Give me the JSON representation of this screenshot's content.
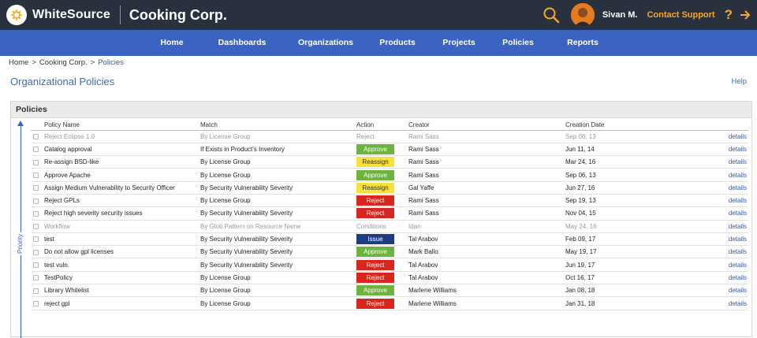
{
  "header": {
    "logo_text": "WhiteSource",
    "company": "Cooking Corp.",
    "user_name": "Sivan M.",
    "contact_support": "Contact Support",
    "help_glyph": "?"
  },
  "nav": {
    "items": [
      {
        "label": "Home"
      },
      {
        "label": "Dashboards"
      },
      {
        "label": "Organizations"
      },
      {
        "label": "Products"
      },
      {
        "label": "Projects"
      },
      {
        "label": "Policies"
      },
      {
        "label": "Reports"
      }
    ]
  },
  "breadcrumb": {
    "home": "Home",
    "sep": ">",
    "org": "Cooking Corp.",
    "current": "Policies"
  },
  "page": {
    "title": "Organizational Policies",
    "help": "Help"
  },
  "panel": {
    "title": "Policies",
    "priority_label": "Priority",
    "columns": {
      "name": "Policy Name",
      "match": "Match",
      "action": "Action",
      "creator": "Creator",
      "date": "Creation Date"
    },
    "rows": [
      {
        "name": "Reject Eclipse 1.0",
        "match": "By License Group",
        "action": "Reject",
        "action_style": "text",
        "creator": "Rami Sass",
        "date": "Sep 06, 13",
        "details": "details",
        "dim": true
      },
      {
        "name": "Catalog approval",
        "match": "If Exists in Product's Inventory",
        "action": "Approve",
        "action_style": "approve",
        "creator": "Rami Sass",
        "date": "Jun 11, 14",
        "details": "details",
        "dim": false
      },
      {
        "name": "Re-assign BSD-like",
        "match": "By License Group",
        "action": "Reassign",
        "action_style": "reassign",
        "creator": "Rami Sass",
        "date": "Mar 24, 16",
        "details": "details",
        "dim": false
      },
      {
        "name": "Approve Apache",
        "match": "By License Group",
        "action": "Approve",
        "action_style": "approve",
        "creator": "Rami Sass",
        "date": "Sep 06, 13",
        "details": "details",
        "dim": false
      },
      {
        "name": "Assign Medium Vulnerability to Security Officer",
        "match": "By Security Vulnerability Severity",
        "action": "Reassign",
        "action_style": "reassign",
        "creator": "Gal Yaffe",
        "date": "Jun 27, 16",
        "details": "details",
        "dim": false
      },
      {
        "name": "Reject GPLs",
        "match": "By License Group",
        "action": "Reject",
        "action_style": "reject",
        "creator": "Rami Sass",
        "date": "Sep 19, 13",
        "details": "details",
        "dim": false
      },
      {
        "name": "Reject high severity security issues",
        "match": "By Security Vulnerability Severity",
        "action": "Reject",
        "action_style": "reject",
        "creator": "Rami Sass",
        "date": "Nov 04, 15",
        "details": "details",
        "dim": false
      },
      {
        "name": "Workflow",
        "match": "By Glob Pattern on Resource Name",
        "action": "Conditions",
        "action_style": "text",
        "creator": "Idan",
        "date": "May 24, 16",
        "details": "details",
        "dim": true
      },
      {
        "name": "test",
        "match": "By Security Vulnerability Severity",
        "action": "Issue",
        "action_style": "issue",
        "creator": "Tal Arabov",
        "date": "Feb 09, 17",
        "details": "details",
        "dim": false
      },
      {
        "name": "Do not allow gpl licenses",
        "match": "By Security Vulnerability Severity",
        "action": "Approve",
        "action_style": "approve",
        "creator": "Mark Ballo",
        "date": "May 19, 17",
        "details": "details",
        "dim": false
      },
      {
        "name": "test vuln.",
        "match": "By Security Vulnerability Severity",
        "action": "Reject",
        "action_style": "reject",
        "creator": "Tal Arabov",
        "date": "Jun 19, 17",
        "details": "details",
        "dim": false
      },
      {
        "name": "TestPolicy",
        "match": "By License Group",
        "action": "Reject",
        "action_style": "reject",
        "creator": "Tal Arabov",
        "date": "Oct 16, 17",
        "details": "details",
        "dim": false
      },
      {
        "name": "Library Whitelist",
        "match": "By License Group",
        "action": "Approve",
        "action_style": "approve",
        "creator": "Marlene Williams",
        "date": "Jan 08, 18",
        "details": "details",
        "dim": false
      },
      {
        "name": "reject gpl",
        "match": "By License Group",
        "action": "Reject",
        "action_style": "reject",
        "creator": "Marlene Williams",
        "date": "Jan 31, 18",
        "details": "details",
        "dim": false
      }
    ]
  },
  "colors": {
    "topbar": "#29313f",
    "nav": "#3b64c2",
    "accent": "#f7a825",
    "approve": "#6db33f",
    "reassign": "#f7e13a",
    "reject": "#d8261f",
    "issue": "#1f3b82"
  },
  "icons": [
    "whitesource-logo-icon",
    "search-icon",
    "avatar",
    "help-icon",
    "logout-icon",
    "priority-arrow-icon",
    "checkbox"
  ]
}
